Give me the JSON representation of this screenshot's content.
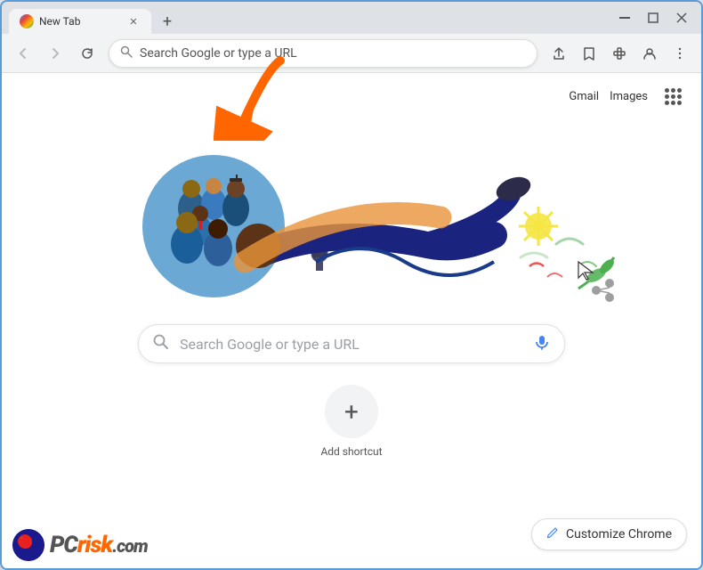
{
  "browser": {
    "tab": {
      "title": "New Tab",
      "favicon_label": "chrome-favicon"
    },
    "new_tab_btn": "+",
    "window_controls": {
      "minimize": "—",
      "maximize": "❐",
      "close": "✕"
    },
    "toolbar": {
      "back": "←",
      "forward": "→",
      "reload": "↻",
      "address_placeholder": "Search Google or type a URL",
      "share_icon": "⬆",
      "bookmark_icon": "☆",
      "extension_icon": "🧩",
      "profile_icon": "👤",
      "menu_icon": "⋮"
    }
  },
  "page": {
    "header": {
      "gmail_label": "Gmail",
      "images_label": "Images"
    },
    "search": {
      "placeholder": "Search Google or type a URL"
    },
    "shortcuts": {
      "add_label": "Add shortcut"
    },
    "customize": {
      "btn_label": "Customize Chrome",
      "icon": "✏"
    }
  },
  "watermark": {
    "text_pc": "PC",
    "text_risk": "risk",
    "text_dotcom": ".com"
  }
}
